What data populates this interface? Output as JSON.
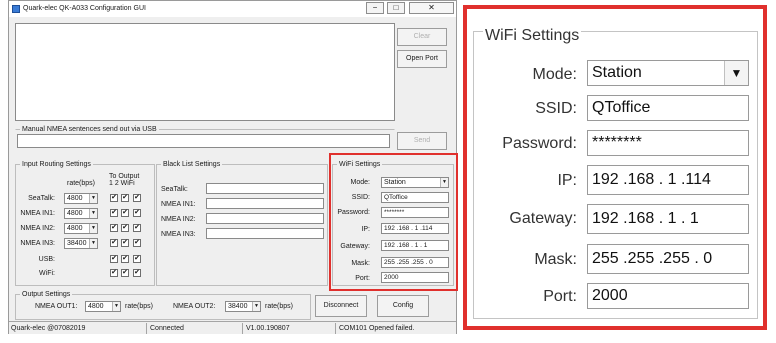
{
  "app": {
    "title": "Quark-elec QK-A033 Configuration GUI",
    "minimize_glyph": "−",
    "maximize_glyph": "□",
    "close_glyph": "✕"
  },
  "top": {
    "clear_label": "Clear",
    "open_port_label": "Open Port",
    "manual_group_title": "Manual NMEA sentences send out via USB",
    "send_label": "Send"
  },
  "input_routing": {
    "title": "Input Routing Settings",
    "rate_header": "rate(bps)",
    "to_output_header": "To Output",
    "output_cols": "1  2  WiFi",
    "check_glyph": "✔",
    "rows": [
      {
        "label": "SeaTalk:",
        "rate": "4800"
      },
      {
        "label": "NMEA IN1:",
        "rate": "4800"
      },
      {
        "label": "NMEA IN2:",
        "rate": "4800"
      },
      {
        "label": "NMEA IN3:",
        "rate": "38400"
      }
    ],
    "usb_label": "USB:",
    "wifi_label": "WiFi:"
  },
  "black_list": {
    "title": "Black List Settings",
    "rows": [
      "SeaTalk:",
      "NMEA IN1:",
      "NMEA IN2:",
      "NMEA IN3:"
    ]
  },
  "wifi": {
    "title": "WiFi Settings",
    "mode_label": "Mode:",
    "mode_value": "Station",
    "ssid_label": "SSID:",
    "ssid_value": "QToffice",
    "password_label": "Password:",
    "password_value": "********",
    "ip_label": "IP:",
    "ip_value": "192 .168 . 1  .114",
    "gateway_label": "Gateway:",
    "gateway_value": "192 .168 . 1  . 1",
    "mask_label": "Mask:",
    "mask_value": "255 .255 .255 . 0",
    "port_label": "Port:",
    "port_value": "2000"
  },
  "output": {
    "title": "Output Settings",
    "out1_label": "NMEA OUT1:",
    "out1_rate": "4800",
    "out2_label": "NMEA OUT2:",
    "out2_rate": "38400",
    "rate_suffix": "rate(bps)",
    "disconnect_label": "Disconnect",
    "config_label": "Config"
  },
  "status": {
    "copyright": "Quark-elec @07082019",
    "connection": "Connected",
    "version": "V1.00.190807",
    "port_message": "COM101 Opened failed."
  },
  "colors": {
    "highlight": "#e0302d",
    "window_bg": "#efefef"
  }
}
